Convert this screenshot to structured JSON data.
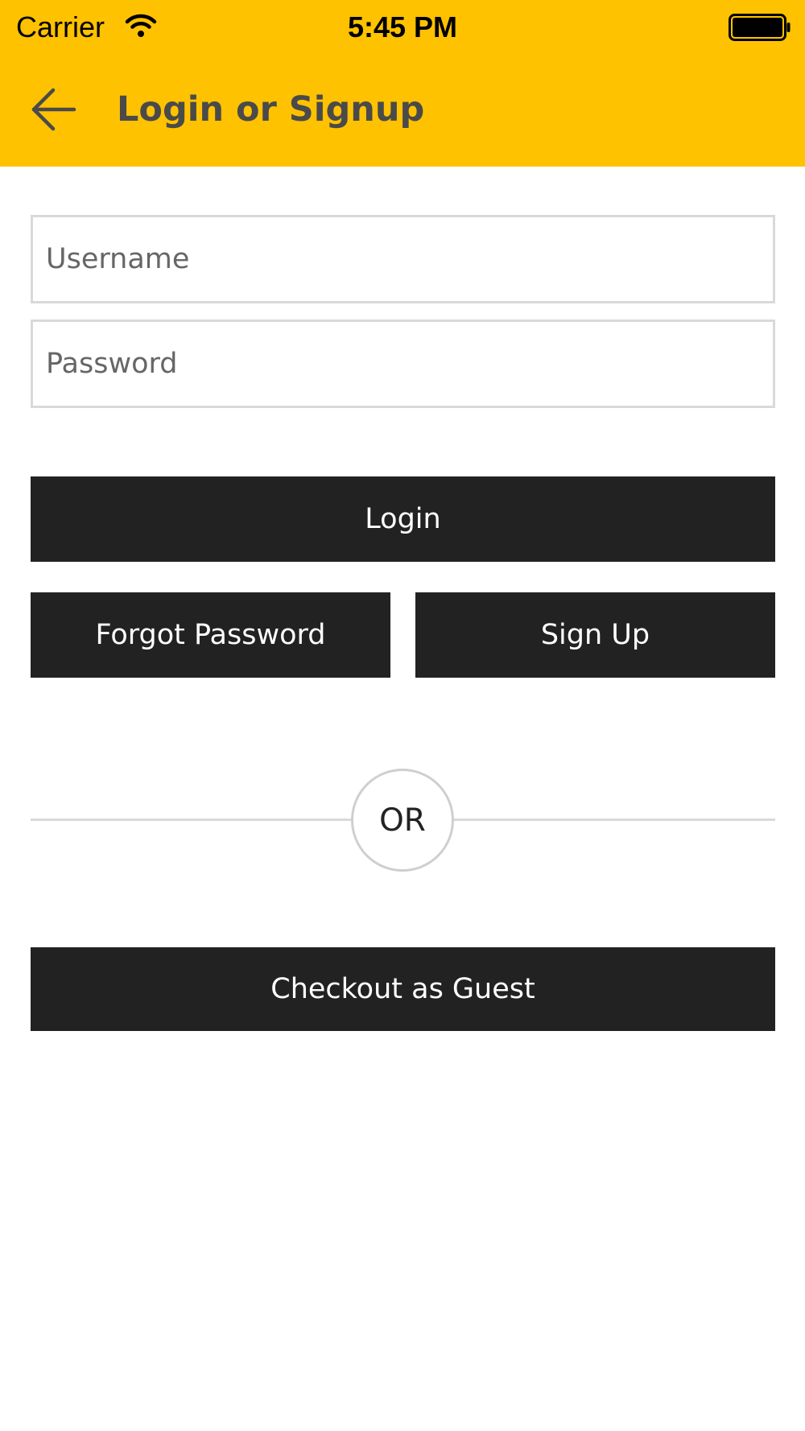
{
  "status_bar": {
    "carrier": "Carrier",
    "time": "5:45 PM",
    "wifi_icon": "wifi-icon",
    "battery_icon": "battery-icon"
  },
  "nav": {
    "back_icon": "back-arrow-icon",
    "title": "Login or Signup"
  },
  "form": {
    "username_placeholder": "Username",
    "username_value": "",
    "password_placeholder": "Password",
    "password_value": "",
    "login_label": "Login",
    "forgot_password_label": "Forgot Password",
    "sign_up_label": "Sign Up",
    "or_label": "OR",
    "guest_label": "Checkout as Guest"
  },
  "colors": {
    "header_background": "#FFC200",
    "title_text": "#4a4a4a",
    "button_background": "#222222",
    "button_text": "#ffffff",
    "border": "#d9d9d9"
  }
}
